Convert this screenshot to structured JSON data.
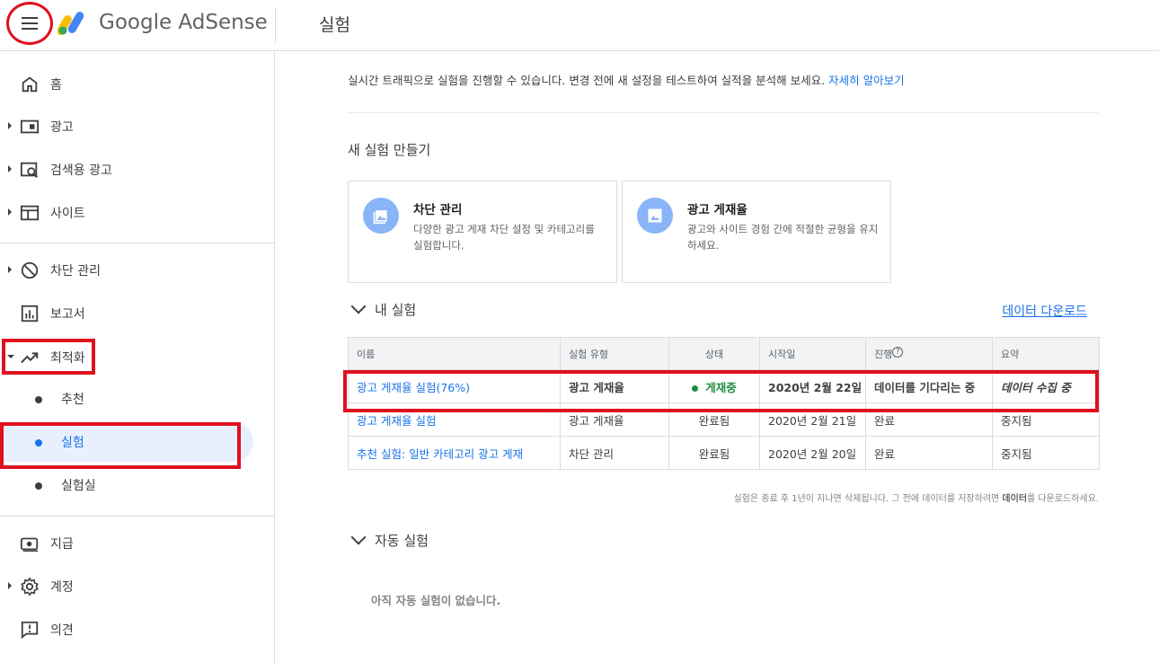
{
  "header": {
    "logo_text": "Google AdSense",
    "page_title": "실험"
  },
  "sidebar": {
    "items": [
      {
        "label": "홈",
        "icon": "home-icon"
      },
      {
        "label": "광고",
        "icon": "ads-icon"
      },
      {
        "label": "검색용 광고",
        "icon": "search-ads-icon"
      },
      {
        "label": "사이트",
        "icon": "sites-icon"
      },
      {
        "label": "차단 관리",
        "icon": "block-icon"
      },
      {
        "label": "보고서",
        "icon": "reports-icon"
      },
      {
        "label": "최적화",
        "icon": "trending-up-icon"
      },
      {
        "label": "지급",
        "icon": "payments-icon"
      },
      {
        "label": "계정",
        "icon": "gear-icon"
      },
      {
        "label": "의견",
        "icon": "feedback-icon"
      }
    ],
    "sub_items": [
      {
        "label": "추천"
      },
      {
        "label": "실험"
      },
      {
        "label": "실험실"
      }
    ]
  },
  "main": {
    "intro_text": "실시간 트래픽으로 실험을 진행할 수 있습니다. 변경 전에 새 설정을 테스트하여 실적을 분석해 보세요.",
    "intro_link": "자세히 알아보기",
    "new_section_title": "새 실험 만들기",
    "cards": [
      {
        "title": "차단 관리",
        "desc": "다양한 광고 게재 차단 설정 및 카테고리를 실험합니다.",
        "icon": "image-icon"
      },
      {
        "title": "광고 게재율",
        "desc": "광고와 사이트 경험 간에 적절한 균형을 유지하세요.",
        "icon": "image-icon"
      }
    ],
    "my_experiments_title": "내 실험",
    "download_label": "데이터 다운로드",
    "table": {
      "headers": [
        "이름",
        "실험 유형",
        "상태",
        "시작일",
        "진행",
        "요약"
      ],
      "rows": [
        {
          "name": "광고 게재율 실험(76%)",
          "type": "광고 게재율",
          "status": "게재중",
          "start": "2020년 2월 22일",
          "progress": "데이터를 기다리는 중",
          "summary": "데이터 수집 중"
        },
        {
          "name": "광고 게재율 실험",
          "type": "광고 게재율",
          "status": "완료됨",
          "start": "2020년 2월 21일",
          "progress": "완료",
          "summary": "중지됨"
        },
        {
          "name": "추천 실험: 일반 카테고리 광고 게재",
          "type": "차단 관리",
          "status": "완료됨",
          "start": "2020년 2월 20일",
          "progress": "완료",
          "summary": "중지됨"
        }
      ]
    },
    "footnote_pre": "실험은 종료 후 1년이 지나면 삭제됩니다. 그 전에 데이터를 저장하려면 ",
    "footnote_bold": "데이터",
    "footnote_post": "를 다운로드하세요.",
    "auto_experiments_title": "자동 실험",
    "auto_empty": "아직 자동 실험이 없습니다."
  },
  "colors": {
    "accent": "#1a73e8",
    "highlight": "#e0101e",
    "status_live": "#1e8e3e"
  }
}
